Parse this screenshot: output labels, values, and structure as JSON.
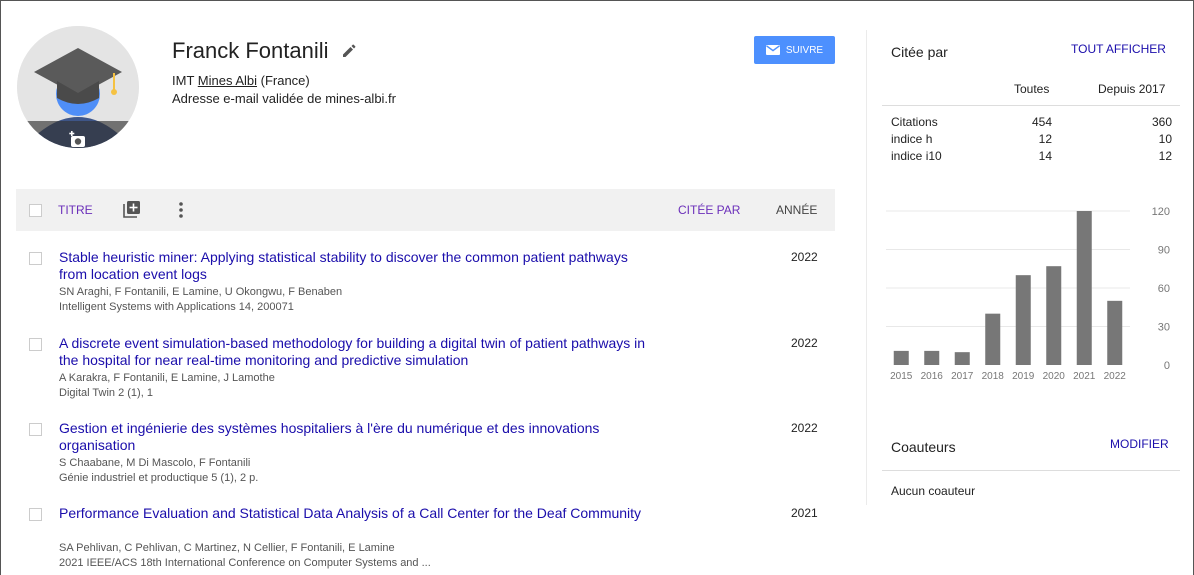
{
  "profile": {
    "name": "Franck Fontanili",
    "affiliation_prefix": "IMT ",
    "affiliation_link": "Mines Albi",
    "affiliation_suffix": " (France)",
    "email_note": "Adresse e-mail validée de mines-albi.fr",
    "follow_label": "SUIVRE"
  },
  "table": {
    "col_title": "TITRE",
    "col_cited": "CITÉE PAR",
    "col_year": "ANNÉE"
  },
  "articles": [
    {
      "title": "Stable heuristic miner: Applying statistical stability to discover the common patient pathways from location event logs",
      "authors": "SN Araghi, F Fontanili, E Lamine, U Okongwu, F Benaben",
      "venue": "Intelligent Systems with Applications 14, 200071",
      "year": "2022"
    },
    {
      "title": "A discrete event simulation-based methodology for building a digital twin of patient pathways in the hospital for near real-time monitoring and predictive simulation",
      "authors": "A Karakra, F Fontanili, E Lamine, J Lamothe",
      "venue": "Digital Twin 2 (1), 1",
      "year": "2022"
    },
    {
      "title": "Gestion et ingénierie des systèmes hospitaliers à l'ère du numérique et des innovations organisation",
      "authors": "S Chaabane, M Di Mascolo, F Fontanili",
      "venue": "Génie industriel et productique 5 (1), 2 p.",
      "year": "2022"
    },
    {
      "title": "Performance Evaluation and Statistical Data Analysis of a Call Center for the Deaf Community",
      "authors": "SA Pehlivan, C Pehlivan, C Martinez, N Cellier, F Fontanili, E Lamine",
      "venue": "2021 IEEE/ACS 18th International Conference on Computer Systems and ...",
      "year": "2021"
    }
  ],
  "sidebar": {
    "cited_by": "Citée par",
    "show_all": "TOUT AFFICHER",
    "hdr_all": "Toutes",
    "hdr_since": "Depuis 2017",
    "stats": [
      {
        "label": "Citations",
        "all": "454",
        "since": "360"
      },
      {
        "label": "indice h",
        "all": "12",
        "since": "10"
      },
      {
        "label": "indice i10",
        "all": "14",
        "since": "12"
      }
    ],
    "coauthors_title": "Coauteurs",
    "coauthors_edit": "MODIFIER",
    "coauthors_none": "Aucun coauteur"
  },
  "colors": {
    "link": "#1a0dab",
    "header_link": "#6b2fba",
    "follow_button": "#4d90fe",
    "bar": "#777777"
  },
  "icons": {
    "edit": "pencil-icon",
    "follow": "envelope-icon",
    "add_photo": "camera-icon",
    "add_article": "add-box-icon",
    "more": "more-vert-icon"
  },
  "chart_data": {
    "type": "bar",
    "categories": [
      "2015",
      "2016",
      "2017",
      "2018",
      "2019",
      "2020",
      "2021",
      "2022"
    ],
    "values": [
      11,
      11,
      10,
      40,
      70,
      77,
      120,
      50
    ],
    "ylim": [
      0,
      120
    ],
    "yticks": [
      0,
      30,
      60,
      90,
      120
    ],
    "grid": true
  }
}
